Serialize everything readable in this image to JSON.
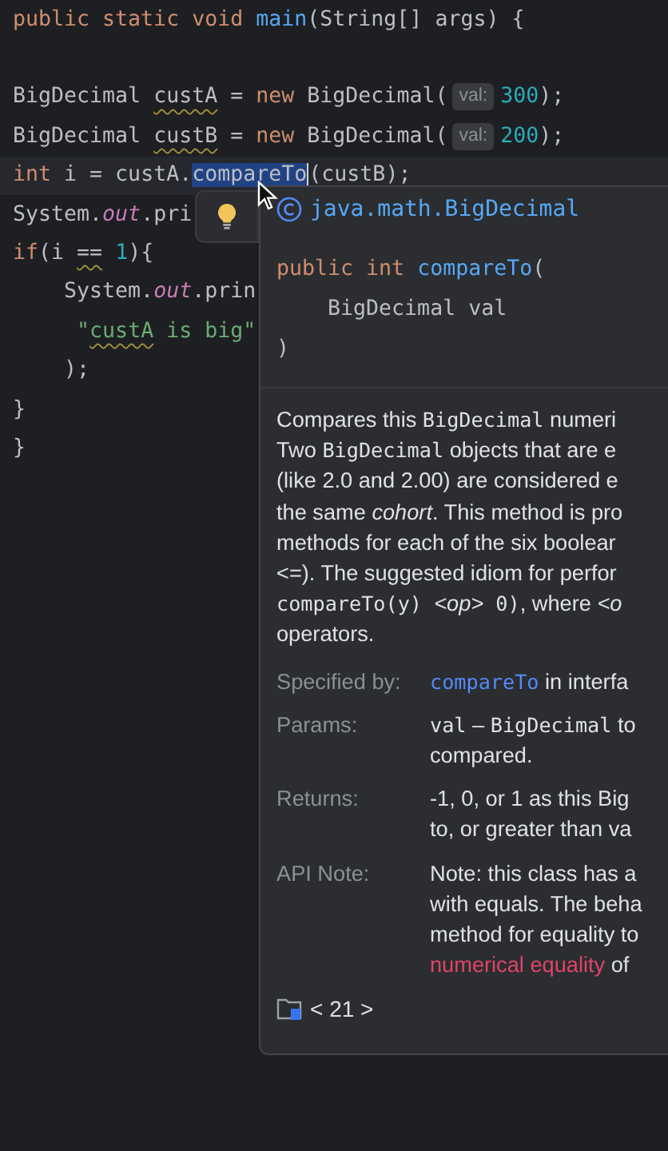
{
  "code_lines": [
    {
      "current": false,
      "tokens": [
        {
          "kind": "keyword",
          "text": "public static void "
        },
        {
          "kind": "method",
          "text": "main"
        },
        {
          "kind": "plain",
          "text": "(String[] args) {"
        }
      ]
    },
    {
      "current": false
    },
    {
      "current": false,
      "tokens": [
        {
          "kind": "plain",
          "text": "BigDecimal "
        },
        {
          "kind": "warn",
          "text": "custA"
        },
        {
          "kind": "plain",
          "text": " = "
        },
        {
          "kind": "keyword",
          "text": "new "
        },
        {
          "kind": "plain",
          "text": "BigDecimal("
        },
        {
          "kind": "hint",
          "text": "val:"
        },
        {
          "kind": "number",
          "text": "300"
        },
        {
          "kind": "plain",
          "text": ");"
        }
      ]
    },
    {
      "current": false,
      "tokens": [
        {
          "kind": "plain",
          "text": "BigDecimal "
        },
        {
          "kind": "warn",
          "text": "custB"
        },
        {
          "kind": "plain",
          "text": " = "
        },
        {
          "kind": "keyword",
          "text": "new "
        },
        {
          "kind": "plain",
          "text": "BigDecimal("
        },
        {
          "kind": "hint",
          "text": "val:"
        },
        {
          "kind": "number",
          "text": "200"
        },
        {
          "kind": "plain",
          "text": ");"
        }
      ]
    },
    {
      "current": true,
      "tokens": [
        {
          "kind": "keyword",
          "text": "int "
        },
        {
          "kind": "plain",
          "text": "i = custA."
        },
        {
          "kind": "selected",
          "text": "compareTo"
        },
        {
          "kind": "plain",
          "text": "(custB);"
        }
      ]
    },
    {
      "current": false,
      "tokens": [
        {
          "kind": "plain",
          "text": "System."
        },
        {
          "kind": "field",
          "text": "out"
        },
        {
          "kind": "plain",
          "text": ".pri"
        }
      ]
    },
    {
      "current": false,
      "tokens": [
        {
          "kind": "keyword",
          "text": "if"
        },
        {
          "kind": "plain",
          "text": "(i "
        },
        {
          "kind": "warn",
          "text": "=="
        },
        {
          "kind": "number",
          "text": " 1"
        },
        {
          "kind": "plain",
          "text": "){"
        }
      ]
    },
    {
      "current": false,
      "tokens": [
        {
          "kind": "plain",
          "text": "    System."
        },
        {
          "kind": "field",
          "text": "out"
        },
        {
          "kind": "plain",
          "text": ".prin"
        }
      ]
    },
    {
      "current": false,
      "tokens": [
        {
          "kind": "string",
          "text": "     \""
        },
        {
          "kind": "string_warn",
          "text": "custA"
        },
        {
          "kind": "string",
          "text": " is big\""
        }
      ]
    },
    {
      "current": false,
      "tokens": [
        {
          "kind": "plain",
          "text": "    );"
        }
      ]
    },
    {
      "current": false,
      "tokens": [
        {
          "kind": "plain",
          "text": "}"
        }
      ]
    },
    {
      "current": false,
      "tokens": [
        {
          "kind": "plain",
          "text": "}"
        }
      ]
    }
  ],
  "popup": {
    "class_name": "java.math.BigDecimal",
    "signature": [
      [
        {
          "kind": "keyword",
          "text": "public int "
        },
        {
          "kind": "method",
          "text": "compareTo"
        },
        {
          "kind": "plain",
          "text": "("
        }
      ],
      [
        {
          "kind": "plain",
          "text": "    BigDecimal val"
        }
      ],
      [
        {
          "kind": "plain",
          "text": ")"
        }
      ]
    ],
    "description": [
      [
        {
          "kind": "text",
          "text": "Compares this "
        },
        {
          "kind": "code",
          "text": "BigDecimal"
        },
        {
          "kind": "text",
          "text": " numeri"
        }
      ],
      [
        {
          "kind": "text",
          "text": "Two "
        },
        {
          "kind": "code",
          "text": "BigDecimal"
        },
        {
          "kind": "text",
          "text": " objects that are e"
        }
      ],
      [
        {
          "kind": "text",
          "text": "(like 2.0 and 2.00) are considered e"
        }
      ],
      [
        {
          "kind": "text",
          "text": "the same "
        },
        {
          "kind": "italic",
          "text": "cohort"
        },
        {
          "kind": "text",
          "text": ". This method is pro"
        }
      ],
      [
        {
          "kind": "text",
          "text": "methods for each of the six boolear"
        }
      ],
      [
        {
          "kind": "text",
          "text": "<=). The suggested idiom for perfor"
        }
      ],
      [
        {
          "kind": "code",
          "text": "compareTo(y) "
        },
        {
          "kind": "italic",
          "text": "<op>"
        },
        {
          "kind": "code",
          "text": " 0)"
        },
        {
          "kind": "text",
          "text": ", where "
        },
        {
          "kind": "italic",
          "text": "<o"
        }
      ],
      [
        {
          "kind": "text",
          "text": "operators."
        }
      ]
    ],
    "sections": [
      {
        "label": "Specified by:",
        "lines": [
          [
            {
              "kind": "link",
              "text": "compareTo"
            },
            {
              "kind": "text",
              "text": " in interfa"
            }
          ]
        ]
      },
      {
        "label": "Params:",
        "lines": [
          [
            {
              "kind": "code",
              "text": "val"
            },
            {
              "kind": "text",
              "text": " – "
            },
            {
              "kind": "code",
              "text": "BigDecimal"
            },
            {
              "kind": "text",
              "text": " to"
            }
          ],
          [
            {
              "kind": "text",
              "text": "compared."
            }
          ]
        ]
      },
      {
        "label": "Returns:",
        "lines": [
          [
            {
              "kind": "text",
              "text": "-1, 0, or 1 as this Big"
            }
          ],
          [
            {
              "kind": "text",
              "text": "to, or greater than va"
            }
          ]
        ]
      },
      {
        "label": "API Note:",
        "lines": [
          [
            {
              "kind": "text",
              "text": "Note: this class has a"
            }
          ],
          [
            {
              "kind": "text",
              "text": "with equals. The beha"
            }
          ],
          [
            {
              "kind": "text",
              "text": "method for equality to"
            }
          ],
          [
            {
              "kind": "red_link",
              "text": "numerical equality"
            },
            {
              "kind": "text",
              "text": " of"
            }
          ]
        ]
      }
    ],
    "footer": {
      "pager": "< 21 >"
    }
  }
}
